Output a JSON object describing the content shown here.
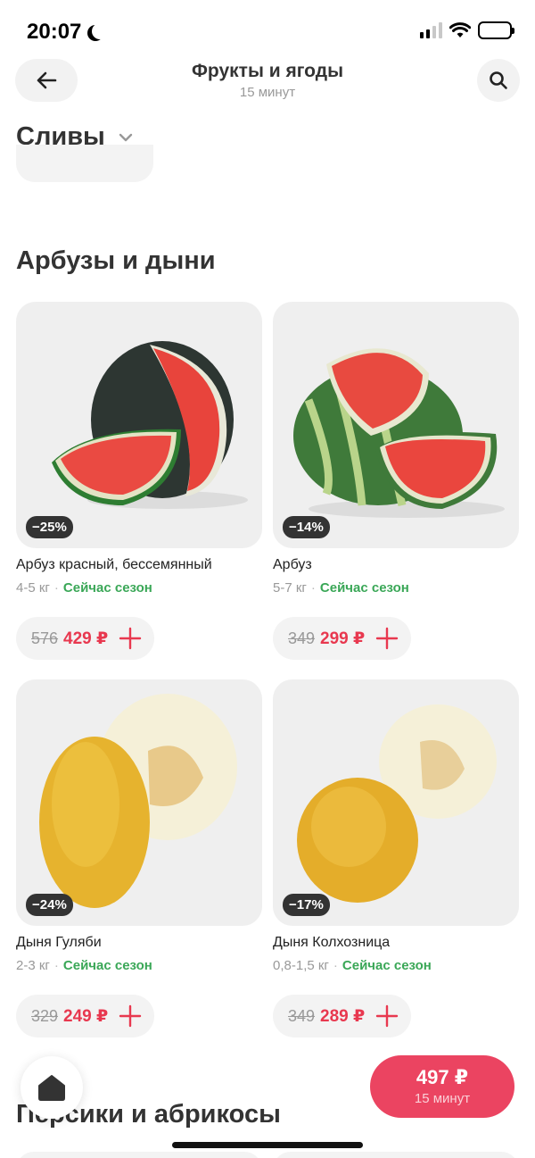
{
  "status_bar": {
    "time": "20:07"
  },
  "header": {
    "title": "Фрукты и ягоды",
    "subtitle": "15 минут"
  },
  "category_prev": {
    "title": "Сливы"
  },
  "section": {
    "title": "Арбузы и дыни",
    "products": [
      {
        "name": "Арбуз красный, бессемянный",
        "weight": "4-5 кг",
        "season": "Сейчас сезон",
        "discount": "−25%",
        "old_price": "576",
        "price": "429 ₽"
      },
      {
        "name": "Арбуз",
        "weight": "5-7 кг",
        "season": "Сейчас сезон",
        "discount": "−14%",
        "old_price": "349",
        "price": "299 ₽"
      },
      {
        "name": "Дыня Гуляби",
        "weight": "2-3 кг",
        "season": "Сейчас сезон",
        "discount": "−24%",
        "old_price": "329",
        "price": "249 ₽"
      },
      {
        "name": "Дыня Колхозница",
        "weight": "0,8-1,5 кг",
        "season": "Сейчас сезон",
        "discount": "−17%",
        "old_price": "349",
        "price": "289 ₽"
      }
    ]
  },
  "next_section": {
    "title": "Персики и абрикосы"
  },
  "cart": {
    "total": "497 ₽",
    "eta": "15 минут"
  },
  "colors": {
    "accent": "#e8384f",
    "cart_bg": "#eb4461",
    "season_green": "#3aa757",
    "card_bg": "#efefef"
  },
  "icons": {
    "back": "arrow-left-icon",
    "search": "search-icon",
    "add": "plus-icon",
    "home": "home-icon",
    "chevron": "chevron-down-icon"
  }
}
